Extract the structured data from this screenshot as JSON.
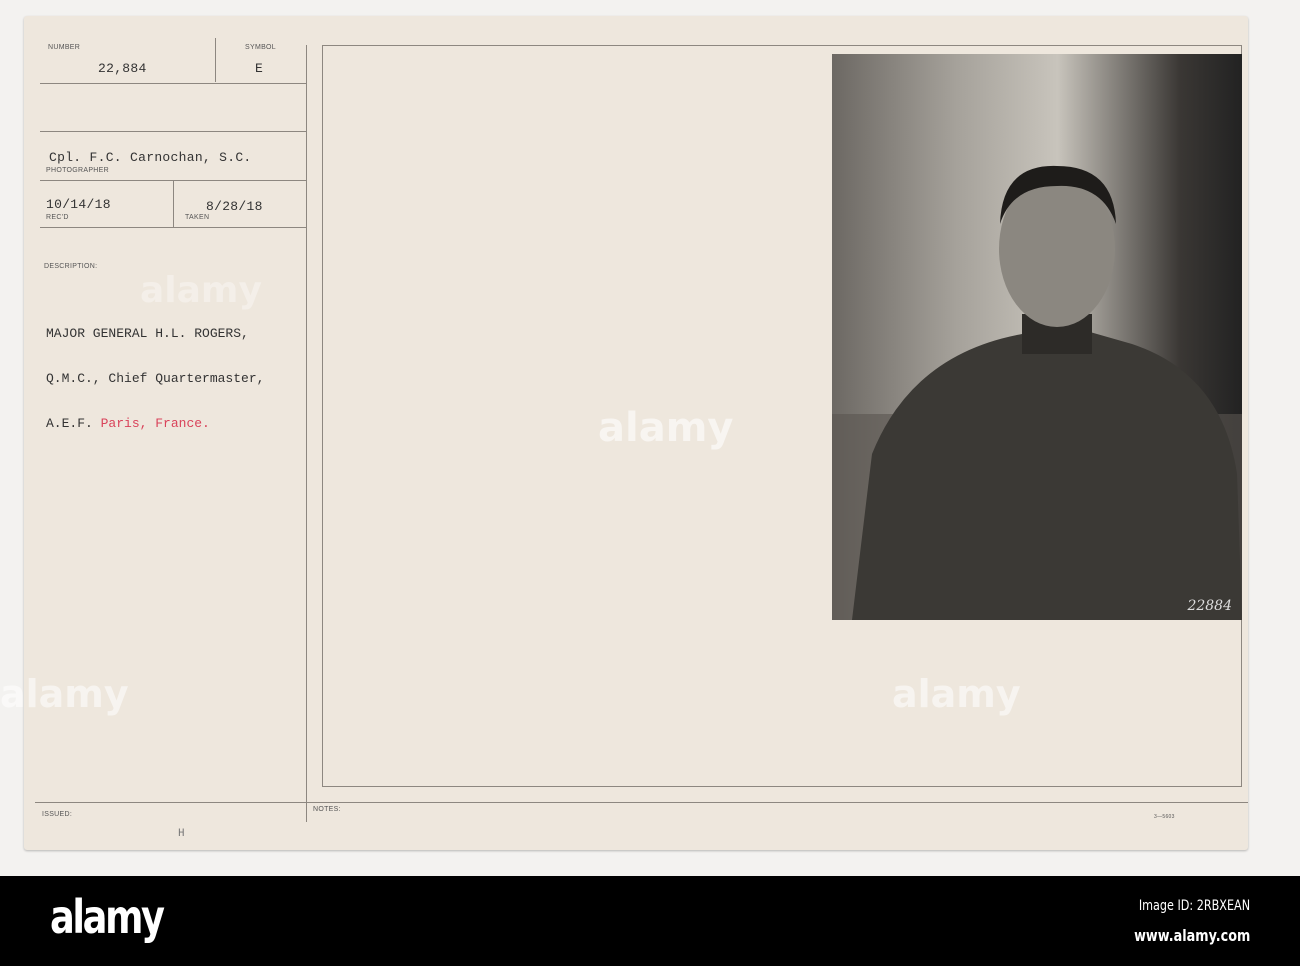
{
  "card": {
    "number_label": "NUMBER",
    "number": "22,884",
    "symbol_label": "SYMBOL",
    "symbol": "E",
    "photographer": "Cpl. F.C. Carnochan, S.C.",
    "photographer_label": "PHOTOGRAPHER",
    "recd": "10/14/18",
    "recd_label": "REC'D",
    "taken": "8/28/18",
    "taken_label": "TAKEN",
    "description_label": "DESCRIPTION:",
    "description_lines": [
      "MAJOR GENERAL H.L. ROGERS,",
      "Q.M.C., Chief Quartermaster,",
      "A.E.F."
    ],
    "description_location": "Paris, France.",
    "issued_label": "ISSUED:",
    "issued_mark": "H",
    "notes_label": "NOTES:",
    "form_number": "3—5603",
    "photo_number": "22884"
  },
  "watermark": "alamy",
  "banner": {
    "logo": "alamy",
    "image_id": "Image ID: 2RBXEAN",
    "website": "www.alamy.com"
  }
}
